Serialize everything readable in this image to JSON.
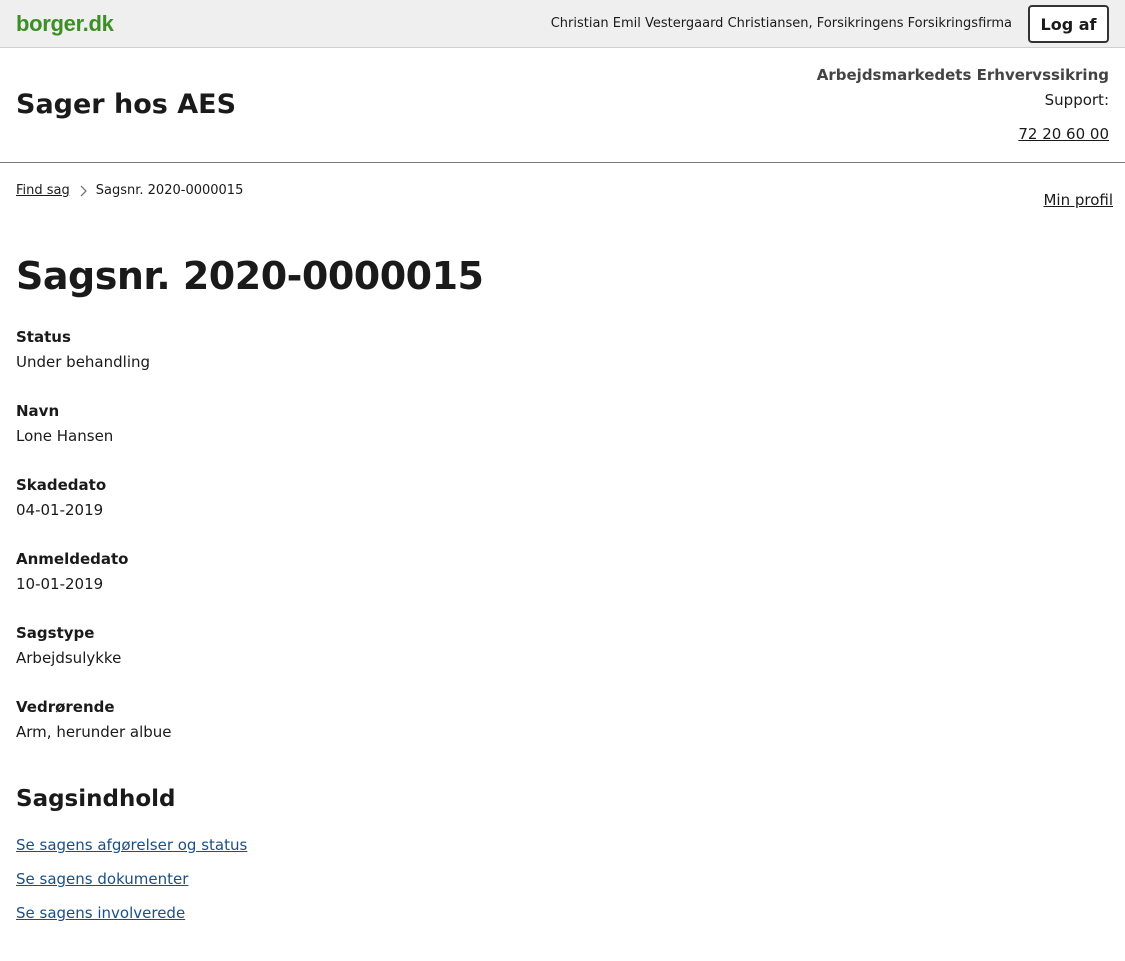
{
  "topbar": {
    "logo": "borger.dk",
    "user": "Christian Emil Vestergaard Christiansen, Forsikringens Forsikringsfirma",
    "logout_label": "Log af"
  },
  "header": {
    "title": "Sager hos AES",
    "org_name": "Arbejdsmarkedets Erhvervssikring",
    "support_label": "Support:",
    "support_phone": "72 20 60 00"
  },
  "breadcrumb": {
    "items": [
      {
        "label": "Find sag"
      },
      {
        "label": "Sagsnr. 2020-0000015"
      }
    ]
  },
  "profile_link": "Min profil",
  "case": {
    "title": "Sagsnr. 2020-0000015",
    "fields": [
      {
        "label": "Status",
        "value": "Under behandling"
      },
      {
        "label": "Navn",
        "value": "Lone Hansen"
      },
      {
        "label": "Skadedato",
        "value": "04-01-2019"
      },
      {
        "label": "Anmeldedato",
        "value": "10-01-2019"
      },
      {
        "label": "Sagstype",
        "value": "Arbejdsulykke"
      },
      {
        "label": "Vedrørende",
        "value": "Arm, herunder albue"
      }
    ]
  },
  "content_section": {
    "title": "Sagsindhold",
    "links": [
      {
        "label": "Se sagens afgørelser og status"
      },
      {
        "label": "Se sagens dokumenter"
      },
      {
        "label": "Se sagens involverede"
      }
    ]
  },
  "colors": {
    "logo": "#3b8f25",
    "link": "#1a4f86",
    "topbar_bg": "#efefef"
  },
  "icons": {
    "breadcrumb_separator": "chevron-right-icon"
  }
}
